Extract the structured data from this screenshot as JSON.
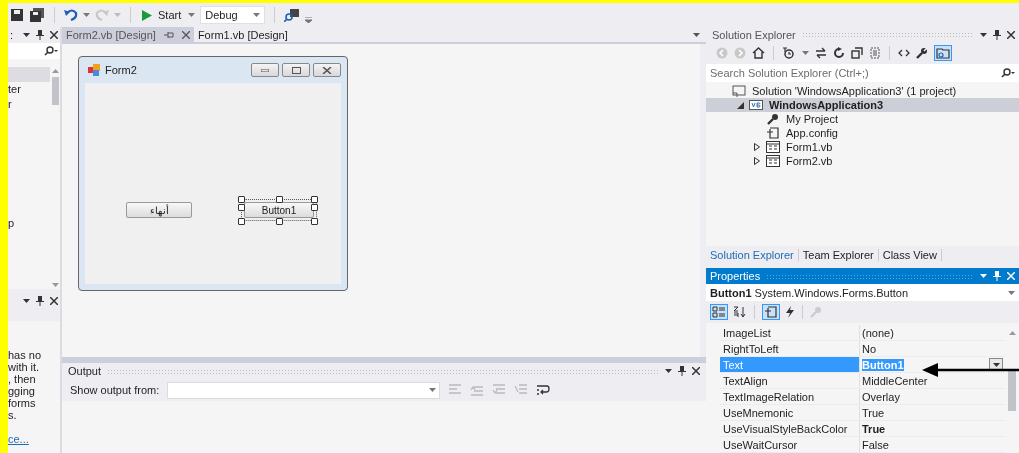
{
  "toolbar": {
    "redo_enabled": false,
    "start_label": "Start",
    "configuration": "Debug"
  },
  "left_top_panel": {
    "header_fragment": ":",
    "items": [
      {
        "selected": true
      },
      {
        "label": "ter",
        "selected": false
      },
      {
        "label": "r",
        "selected": false
      },
      {
        "label": "p",
        "selected": false
      }
    ]
  },
  "left_bottom_panel": {
    "description_lines": [
      "has no",
      "with it.",
      ", then",
      "gging",
      "forms",
      "s."
    ],
    "link": "ce..."
  },
  "document_tabs": [
    {
      "label": "Form2.vb [Design]",
      "selected": true
    },
    {
      "label": "Form1.vb [Design]",
      "selected": false
    }
  ],
  "form_window": {
    "title": "Form2",
    "buttons": [
      {
        "label": "أنهاء",
        "selected": false
      },
      {
        "label": "Button1",
        "selected": true
      }
    ]
  },
  "output": {
    "title": "Output",
    "show_output_label": "Show output from:"
  },
  "solution_explorer": {
    "title": "Solution Explorer",
    "search_placeholder": "Search Solution Explorer (Ctrl+;)",
    "tree": [
      {
        "label": "Solution 'WindowsApplication3' (1 project)",
        "kind": "solution",
        "selected": false,
        "children": [
          {
            "label": "WindowsApplication3",
            "kind": "vb-project",
            "expanded": true,
            "selected": true,
            "children": [
              {
                "label": "My Project",
                "kind": "wrench",
                "selected": false
              },
              {
                "label": "App.config",
                "kind": "config",
                "selected": false
              },
              {
                "label": "Form1.vb",
                "kind": "form",
                "expanded": false,
                "selected": false
              },
              {
                "label": "Form2.vb",
                "kind": "form",
                "expanded": false,
                "selected": false
              }
            ]
          }
        ]
      }
    ],
    "tabs": [
      {
        "label": "Solution Explorer",
        "selected": true
      },
      {
        "label": "Team Explorer",
        "selected": false
      },
      {
        "label": "Class View",
        "selected": false
      }
    ]
  },
  "properties": {
    "title": "Properties",
    "object_name": "Button1",
    "object_type": "System.Windows.Forms.Button",
    "rows": [
      {
        "name": "ImageList",
        "value": "(none)",
        "selected": false,
        "modified": false
      },
      {
        "name": "RightToLeft",
        "value": "No",
        "selected": false,
        "modified": false
      },
      {
        "name": "Text",
        "value": "Button1",
        "selected": true,
        "modified": false
      },
      {
        "name": "TextAlign",
        "value": "MiddleCenter",
        "selected": false,
        "modified": false
      },
      {
        "name": "TextImageRelation",
        "value": "Overlay",
        "selected": false,
        "modified": false
      },
      {
        "name": "UseMnemonic",
        "value": "True",
        "selected": false,
        "modified": false
      },
      {
        "name": "UseVisualStyleBackColor",
        "value": "True",
        "selected": false,
        "modified": true
      },
      {
        "name": "UseWaitCursor",
        "value": "False",
        "selected": false,
        "modified": false
      }
    ]
  }
}
